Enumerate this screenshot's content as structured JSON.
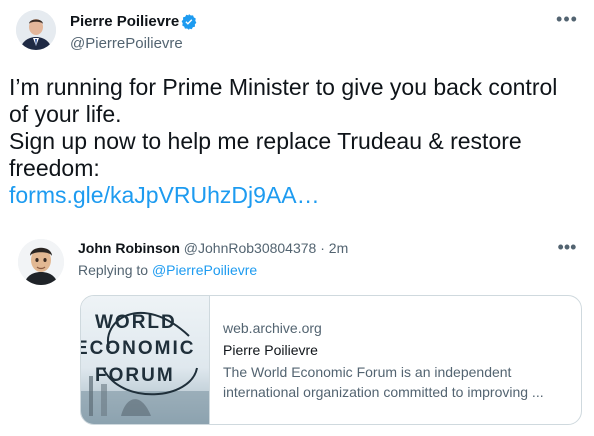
{
  "tweet": {
    "author_name": "Pierre Poilievre",
    "handle": "@PierrePoilievre",
    "more_label": "•••",
    "text_line1": "I’m running for Prime Minister to give you back control of your life.",
    "text_line2": "Sign up now to help me replace Trudeau & restore freedom:",
    "link": "forms.gle/kaJpVRUhzDj9AA…"
  },
  "reply": {
    "author_name": "John Robinson",
    "handle": "@JohnRob30804378",
    "separator": " · ",
    "time": "2m",
    "more_label": "•••",
    "replying_prefix": "Replying to ",
    "replying_to": "@PierrePoilievre"
  },
  "card": {
    "image_text": [
      "WORLD",
      "ECONOMIC",
      "FORUM"
    ],
    "domain": "web.archive.org",
    "title": "Pierre Poilievre",
    "description": "The World Economic Forum is an independent international organization committed to improving ..."
  },
  "colors": {
    "link": "#1d9bf0",
    "muted": "#536471",
    "text": "#0f1419",
    "border": "#cfd9de"
  }
}
